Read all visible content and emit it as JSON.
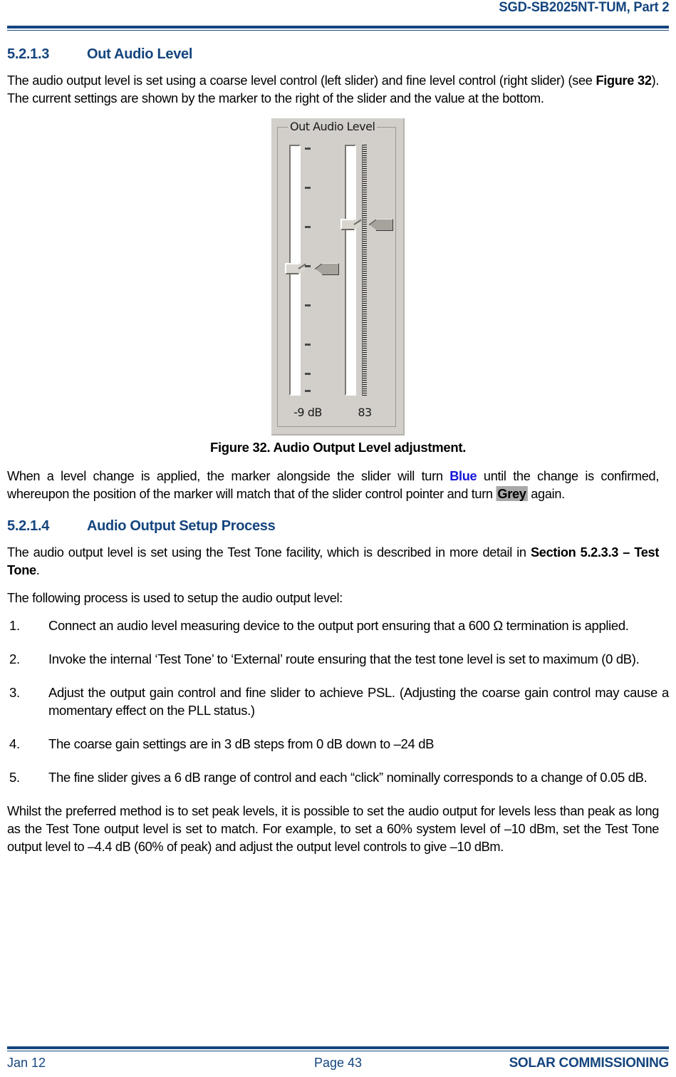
{
  "header": {
    "title": "SGD-SB2025NT-TUM, Part 2"
  },
  "sections": [
    {
      "number": "5.2.1.3",
      "title": "Out Audio Level"
    },
    {
      "number": "5.2.1.4",
      "title": "Audio Output Setup Process"
    }
  ],
  "paragraphs": {
    "intro_a": "The audio output level is set using a coarse level control (left slider) and fine level control (right slider) (see ",
    "intro_fig_ref": "Figure 32",
    "intro_b": ").  The current settings are shown by the marker to the right of the slider and the value at the bottom.",
    "marker_a": "When a level change is applied, the marker alongside the slider will turn ",
    "marker_blue": "Blue",
    "marker_b": " until the change is confirmed, whereupon the position of the marker will match that of the slider control pointer and turn ",
    "marker_grey": "Grey",
    "marker_c": " again.",
    "setup_a": "The audio output level is set using the Test Tone facility, which is described in more detail in ",
    "setup_ref": "Section 5.2.3.3 – Test Tone",
    "setup_b": ".",
    "process_lead": "The following process is used to setup the audio output level:",
    "closing": "Whilst the preferred method is to set peak levels, it is possible to set the audio output for levels less than peak as long as the Test Tone output level is set to match.  For example, to set a 60% system level of –10 dBm, set the Test Tone output level to –4.4 dB (60% of peak) and adjust the output level controls to give –10 dBm."
  },
  "steps": [
    {
      "number": "1.",
      "text": "Connect an audio level measuring device to the output port ensuring that a 600 Ω termination is applied."
    },
    {
      "number": "2.",
      "text": "Invoke the internal ‘Test Tone’ to ‘External’ route ensuring that the test tone level is set to maximum (0 dB)."
    },
    {
      "number": "3.",
      "text": "Adjust the output gain control and fine slider to achieve PSL.  (Adjusting the coarse gain control may cause a momentary effect on the PLL status.)"
    },
    {
      "number": "4.",
      "text": "The coarse gain settings are in 3 dB steps from 0 dB down to –24 dB"
    },
    {
      "number": "5.",
      "text": "The fine slider gives a 6 dB range of control and each “click” nominally corresponds to a change of 0.05 dB."
    }
  ],
  "figure": {
    "caption": "Figure 32.  Audio Output Level adjustment.",
    "panel": {
      "groupbox_label": "Out Audio Level",
      "background_color": "#d2cfca",
      "coarse_slider": {
        "name": "coarse-level-slider",
        "value_label": "-9 dB",
        "tick_count": 9,
        "thumb_position_pct": 45,
        "marker_position_pct": 45,
        "marker_color": "#a6a39d"
      },
      "fine_slider": {
        "name": "fine-level-slider",
        "value_label": "83",
        "tick_style": "dense",
        "thumb_position_pct": 32,
        "marker_position_pct": 32,
        "marker_color": "#a6a39d"
      }
    }
  },
  "footer": {
    "date": "Jan 12",
    "page": "Page 43",
    "company": "SOLAR COMMISSIONING"
  },
  "colors": {
    "brand_blue": "#14457e",
    "link_blue": "#1616d8",
    "grey_highlight": "#a8a8a8"
  }
}
